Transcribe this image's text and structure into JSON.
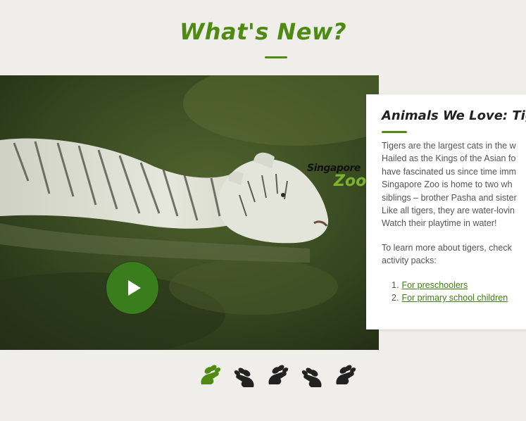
{
  "section": {
    "title": "What's New?"
  },
  "video": {
    "logo_line1": "Singapore",
    "logo_line2": "Zoo",
    "play_icon": "play-icon"
  },
  "card": {
    "title": "Animals We Love: Tiger",
    "description_lines": [
      "Tigers are the largest cats in the w",
      "Hailed as the Kings of the Asian fo",
      "have fascinated us since time imm",
      "Singapore Zoo is home to two wh",
      "siblings – brother Pasha and sister",
      "Like all tigers, they are water-lovin",
      "Watch their playtime in water!"
    ],
    "learn_more_lines": [
      "To learn more about tigers, check",
      "activity packs:"
    ],
    "links": [
      {
        "num": "1.",
        "label": "For preschoolers"
      },
      {
        "num": "2.",
        "label": "For primary school children"
      }
    ]
  },
  "pager": {
    "items": [
      {
        "icon": "paw-icon",
        "active": true
      },
      {
        "icon": "paw-icon",
        "active": false
      },
      {
        "icon": "paw-icon",
        "active": false
      },
      {
        "icon": "paw-icon",
        "active": false
      },
      {
        "icon": "paw-icon",
        "active": false
      }
    ],
    "active_color": "#4f8a12",
    "inactive_color": "#222222"
  },
  "colors": {
    "accent": "#4f8a12",
    "background": "#efeeea"
  }
}
